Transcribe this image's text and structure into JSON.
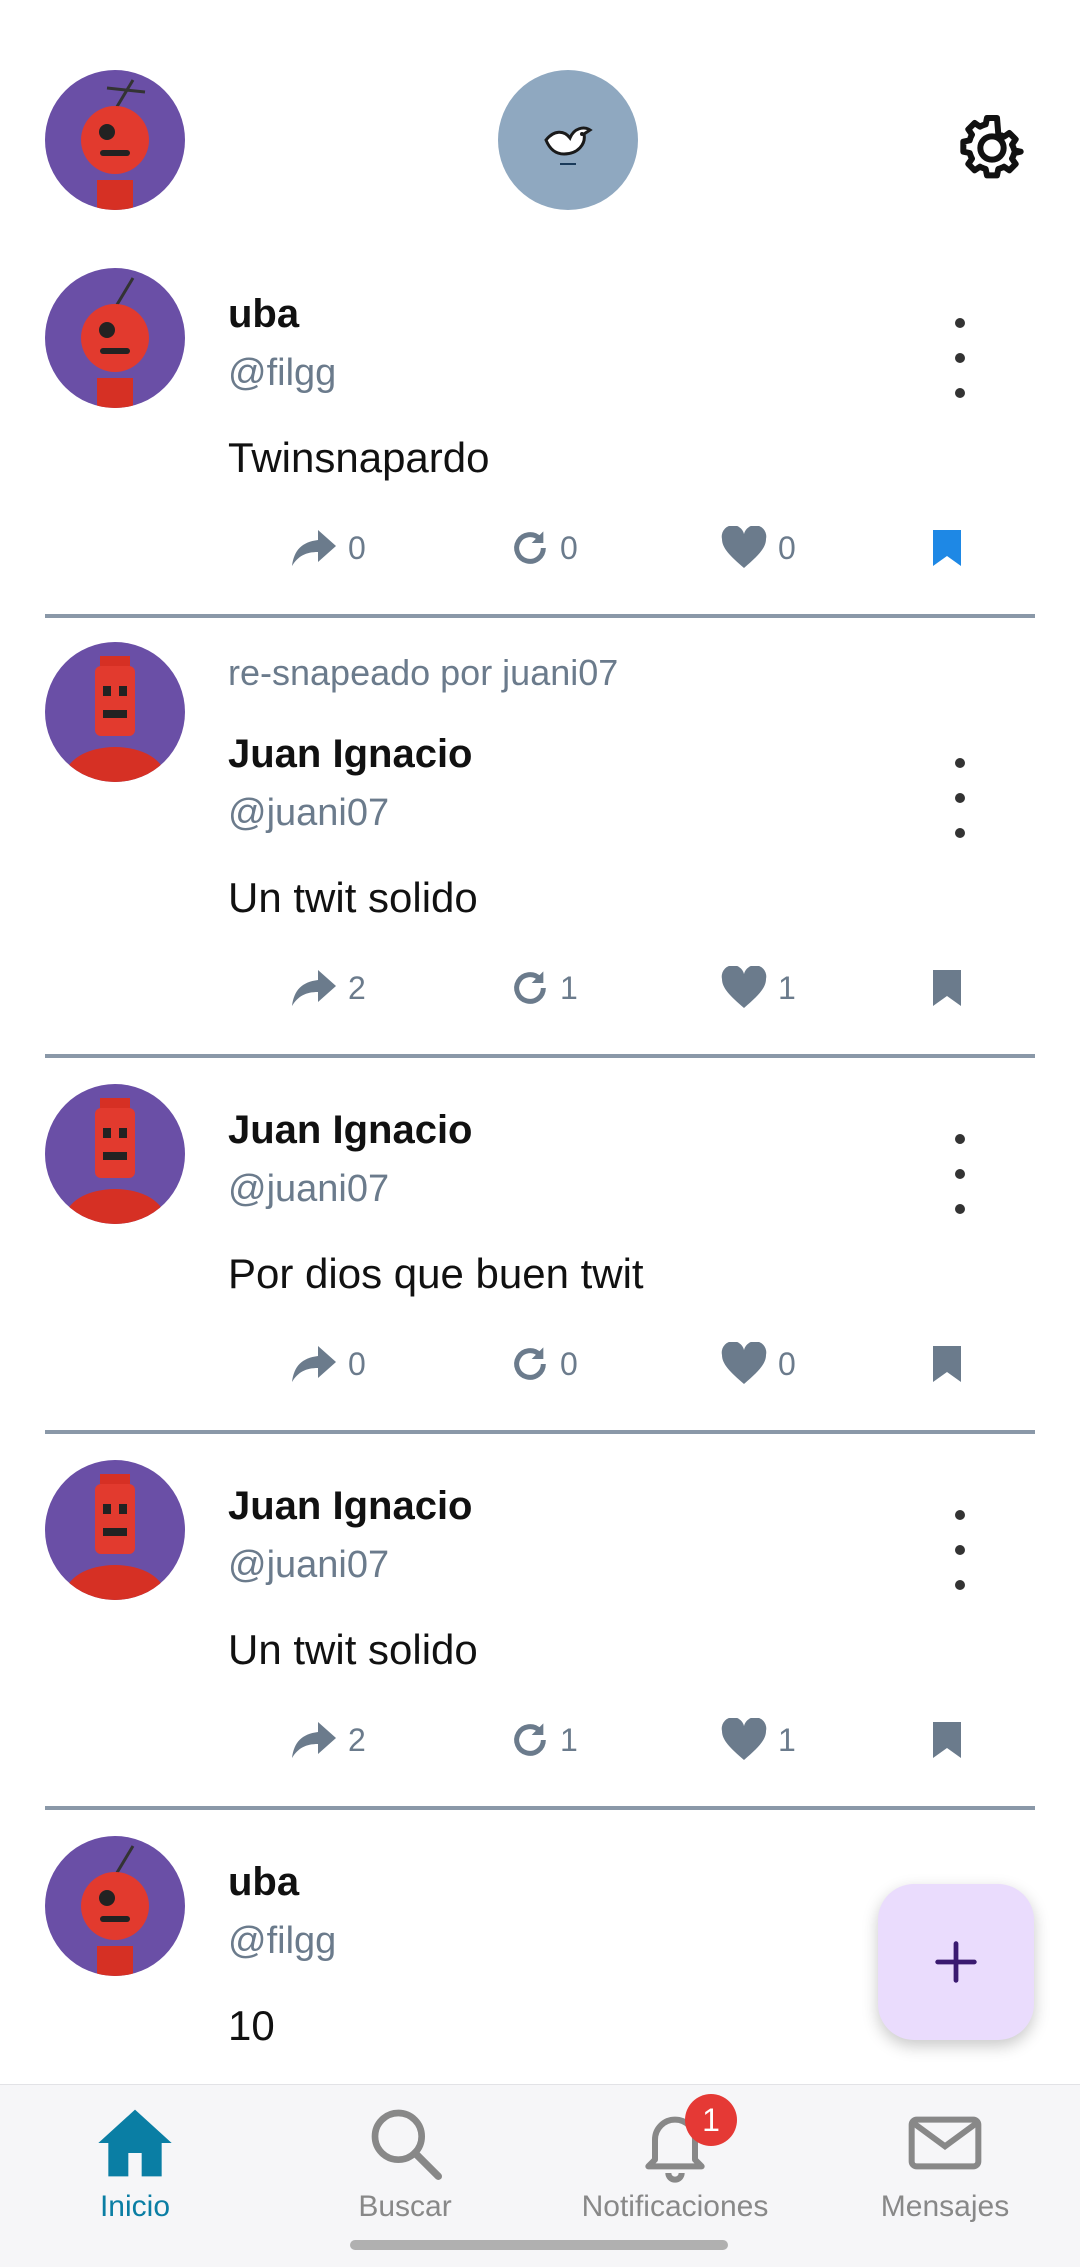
{
  "header": {
    "profile_avatar": "robot-avatar",
    "logo_icon": "bird-icon",
    "settings_icon": "gear-icon"
  },
  "posts": [
    {
      "resnap": "",
      "name": "uba",
      "handle": "@filgg",
      "text": "Twinsnapardo",
      "shares": "0",
      "resnaps": "0",
      "likes": "0",
      "bookmarked": true
    },
    {
      "resnap": "re-snapeado por juani07",
      "name": "Juan Ignacio",
      "handle": "@juani07",
      "text": "Un twit solido",
      "shares": "2",
      "resnaps": "1",
      "likes": "1",
      "bookmarked": false
    },
    {
      "resnap": "",
      "name": "Juan Ignacio",
      "handle": "@juani07",
      "text": "Por dios que buen twit",
      "shares": "0",
      "resnaps": "0",
      "likes": "0",
      "bookmarked": false
    },
    {
      "resnap": "",
      "name": "Juan Ignacio",
      "handle": "@juani07",
      "text": "Un twit solido",
      "shares": "2",
      "resnaps": "1",
      "likes": "1",
      "bookmarked": false
    },
    {
      "resnap": "",
      "name": "uba",
      "handle": "@filgg",
      "text": "10"
    }
  ],
  "fab": {
    "icon": "plus-icon"
  },
  "nav": {
    "items": [
      {
        "label": "Inicio",
        "icon": "home-icon",
        "active": true
      },
      {
        "label": "Buscar",
        "icon": "search-icon",
        "active": false
      },
      {
        "label": "Notificaciones",
        "icon": "bell-icon",
        "active": false
      },
      {
        "label": "Mensajes",
        "icon": "mail-icon",
        "active": false
      }
    ],
    "notification_count": "1"
  },
  "colors": {
    "accent": "#0a7ea4",
    "bookmark_active": "#1e88e5",
    "muted": "#6b7b8c",
    "avatar_bg": "#6a4fa6",
    "fab_bg": "#eadcfd"
  }
}
